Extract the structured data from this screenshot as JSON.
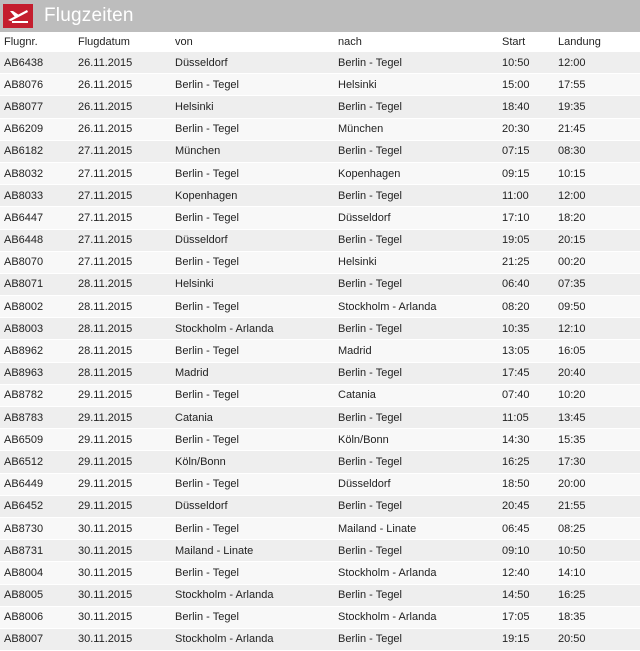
{
  "header": {
    "title": "Flugzeiten",
    "logo_icon": "airline-logo-icon",
    "accent_color": "#c41e2e"
  },
  "table": {
    "columns": [
      "Flugnr.",
      "Flugdatum",
      "von",
      "nach",
      "Start",
      "Landung"
    ],
    "rows": [
      [
        "AB6438",
        "26.11.2015",
        "Düsseldorf",
        "Berlin - Tegel",
        "10:50",
        "12:00"
      ],
      [
        "AB8076",
        "26.11.2015",
        "Berlin - Tegel",
        "Helsinki",
        "15:00",
        "17:55"
      ],
      [
        "AB8077",
        "26.11.2015",
        "Helsinki",
        "Berlin - Tegel",
        "18:40",
        "19:35"
      ],
      [
        "AB6209",
        "26.11.2015",
        "Berlin - Tegel",
        "München",
        "20:30",
        "21:45"
      ],
      [
        "AB6182",
        "27.11.2015",
        "München",
        "Berlin - Tegel",
        "07:15",
        "08:30"
      ],
      [
        "AB8032",
        "27.11.2015",
        "Berlin - Tegel",
        "Kopenhagen",
        "09:15",
        "10:15"
      ],
      [
        "AB8033",
        "27.11.2015",
        "Kopenhagen",
        "Berlin - Tegel",
        "11:00",
        "12:00"
      ],
      [
        "AB6447",
        "27.11.2015",
        "Berlin - Tegel",
        "Düsseldorf",
        "17:10",
        "18:20"
      ],
      [
        "AB6448",
        "27.11.2015",
        "Düsseldorf",
        "Berlin - Tegel",
        "19:05",
        "20:15"
      ],
      [
        "AB8070",
        "27.11.2015",
        "Berlin - Tegel",
        "Helsinki",
        "21:25",
        "00:20"
      ],
      [
        "AB8071",
        "28.11.2015",
        "Helsinki",
        "Berlin - Tegel",
        "06:40",
        "07:35"
      ],
      [
        "AB8002",
        "28.11.2015",
        "Berlin - Tegel",
        "Stockholm - Arlanda",
        "08:20",
        "09:50"
      ],
      [
        "AB8003",
        "28.11.2015",
        "Stockholm - Arlanda",
        "Berlin - Tegel",
        "10:35",
        "12:10"
      ],
      [
        "AB8962",
        "28.11.2015",
        "Berlin - Tegel",
        "Madrid",
        "13:05",
        "16:05"
      ],
      [
        "AB8963",
        "28.11.2015",
        "Madrid",
        "Berlin - Tegel",
        "17:45",
        "20:40"
      ],
      [
        "AB8782",
        "29.11.2015",
        "Berlin - Tegel",
        "Catania",
        "07:40",
        "10:20"
      ],
      [
        "AB8783",
        "29.11.2015",
        "Catania",
        "Berlin - Tegel",
        "11:05",
        "13:45"
      ],
      [
        "AB6509",
        "29.11.2015",
        "Berlin - Tegel",
        "Köln/Bonn",
        "14:30",
        "15:35"
      ],
      [
        "AB6512",
        "29.11.2015",
        "Köln/Bonn",
        "Berlin - Tegel",
        "16:25",
        "17:30"
      ],
      [
        "AB6449",
        "29.11.2015",
        "Berlin - Tegel",
        "Düsseldorf",
        "18:50",
        "20:00"
      ],
      [
        "AB6452",
        "29.11.2015",
        "Düsseldorf",
        "Berlin - Tegel",
        "20:45",
        "21:55"
      ],
      [
        "AB8730",
        "30.11.2015",
        "Berlin - Tegel",
        "Mailand - Linate",
        "06:45",
        "08:25"
      ],
      [
        "AB8731",
        "30.11.2015",
        "Mailand - Linate",
        "Berlin - Tegel",
        "09:10",
        "10:50"
      ],
      [
        "AB8004",
        "30.11.2015",
        "Berlin - Tegel",
        "Stockholm - Arlanda",
        "12:40",
        "14:10"
      ],
      [
        "AB8005",
        "30.11.2015",
        "Stockholm - Arlanda",
        "Berlin - Tegel",
        "14:50",
        "16:25"
      ],
      [
        "AB8006",
        "30.11.2015",
        "Berlin - Tegel",
        "Stockholm - Arlanda",
        "17:05",
        "18:35"
      ],
      [
        "AB8007",
        "30.11.2015",
        "Stockholm - Arlanda",
        "Berlin - Tegel",
        "19:15",
        "20:50"
      ]
    ]
  }
}
